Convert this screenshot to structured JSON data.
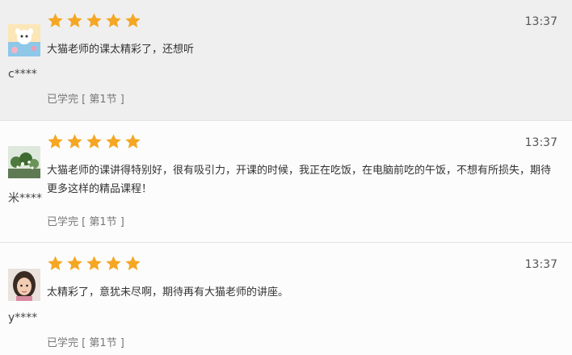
{
  "reviews": [
    {
      "rating": 5,
      "time": "13:37",
      "content": "大猫老师的课太精彩了，还想听",
      "user": "c****",
      "status": "已学完 [ 第1节 ]",
      "avatar_icon": "avatar-cartoon-icon"
    },
    {
      "rating": 5,
      "time": "13:37",
      "content": "大猫老师的课讲得特别好，很有吸引力，开课的时候，我正在吃饭，在电脑前吃的午饭，不想有所损失，期待更多这样的精品课程！",
      "user": "米****",
      "status": "已学完 [ 第1节 ]",
      "avatar_icon": "avatar-plant-icon"
    },
    {
      "rating": 5,
      "time": "13:37",
      "content": "太精彩了，意犹未尽啊，期待再有大猫老师的讲座。",
      "user": "y****",
      "status": "已学完 [ 第1节 ]",
      "avatar_icon": "avatar-girl-icon"
    }
  ],
  "colors": {
    "star": "#f5a623",
    "first_row_bg": "#efefef"
  }
}
